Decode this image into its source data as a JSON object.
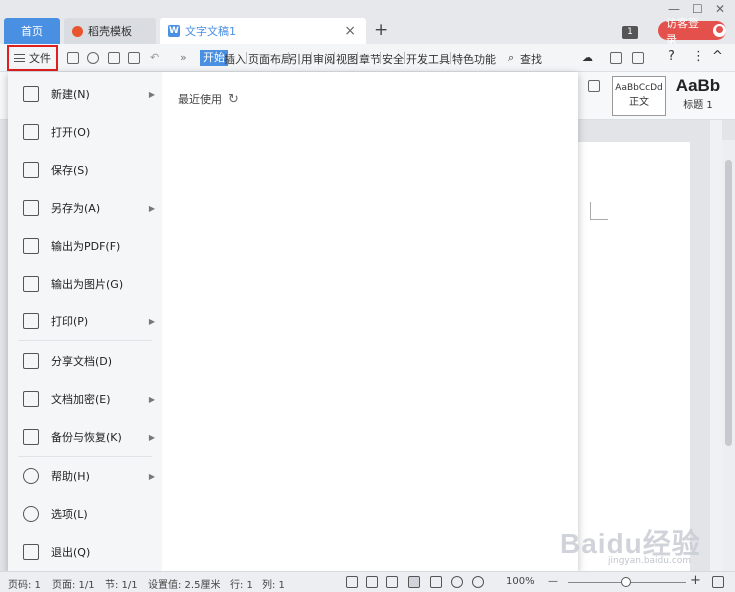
{
  "window": {
    "minimize_glyph": "—",
    "maximize_glyph": "☐",
    "close_glyph": "✕"
  },
  "tabs": {
    "home": "首页",
    "template": "稻壳模板",
    "document": "文字文稿1",
    "close_glyph": "×",
    "add_glyph": "+"
  },
  "header": {
    "badge": "1",
    "login_label": "访客登录"
  },
  "toolbar": {
    "file_label": "文件",
    "more_glyph": "»",
    "ribbon_tabs": [
      "开始",
      "插入",
      "页面布局",
      "引用",
      "审阅",
      "视图",
      "章节",
      "安全",
      "开发工具",
      "特色功能"
    ],
    "search_label": "查找",
    "help_glyph": "?",
    "more_vert": "⋮",
    "collapse_glyph": "^"
  },
  "styles": {
    "normal_preview": "AaBbCcDd",
    "normal_label": "正文",
    "heading1_preview": "AaBb",
    "heading1_label": "标题 1"
  },
  "file_menu": {
    "items": [
      {
        "label": "新建(N)",
        "icon": "new-doc-icon",
        "has_arrow": true
      },
      {
        "label": "打开(O)",
        "icon": "folder-open-icon",
        "has_arrow": false
      },
      {
        "label": "保存(S)",
        "icon": "save-icon",
        "has_arrow": false
      },
      {
        "label": "另存为(A)",
        "icon": "save-as-icon",
        "has_arrow": true
      },
      {
        "label": "输出为PDF(F)",
        "icon": "pdf-export-icon",
        "has_arrow": false
      },
      {
        "label": "输出为图片(G)",
        "icon": "image-export-icon",
        "has_arrow": false
      },
      {
        "label": "打印(P)",
        "icon": "printer-icon",
        "has_arrow": true
      },
      {
        "label": "分享文档(D)",
        "icon": "share-icon",
        "has_arrow": false
      },
      {
        "label": "文档加密(E)",
        "icon": "encrypt-icon",
        "has_arrow": true
      },
      {
        "label": "备份与恢复(K)",
        "icon": "backup-icon",
        "has_arrow": true
      },
      {
        "label": "帮助(H)",
        "icon": "help-icon",
        "has_arrow": true
      },
      {
        "label": "选项(L)",
        "icon": "options-gear-icon",
        "has_arrow": false
      },
      {
        "label": "退出(Q)",
        "icon": "exit-icon",
        "has_arrow": false
      }
    ],
    "recent_label": "最近使用",
    "arrow_glyph": "▶"
  },
  "statusbar": {
    "page_no": "页码: 1",
    "pages": "页面: 1/1",
    "section": "节: 1/1",
    "setting": "设置值: 2.5厘米",
    "row": "行: 1",
    "col": "列: 1",
    "zoom": "100%",
    "zoom_minus": "—",
    "zoom_plus": "+"
  },
  "watermark": {
    "text": "Baidu经验",
    "sub": "jingyan.baidu.com"
  },
  "colors": {
    "accent": "#4a90e2",
    "highlight": "#e02020",
    "login": "#e4504b"
  }
}
